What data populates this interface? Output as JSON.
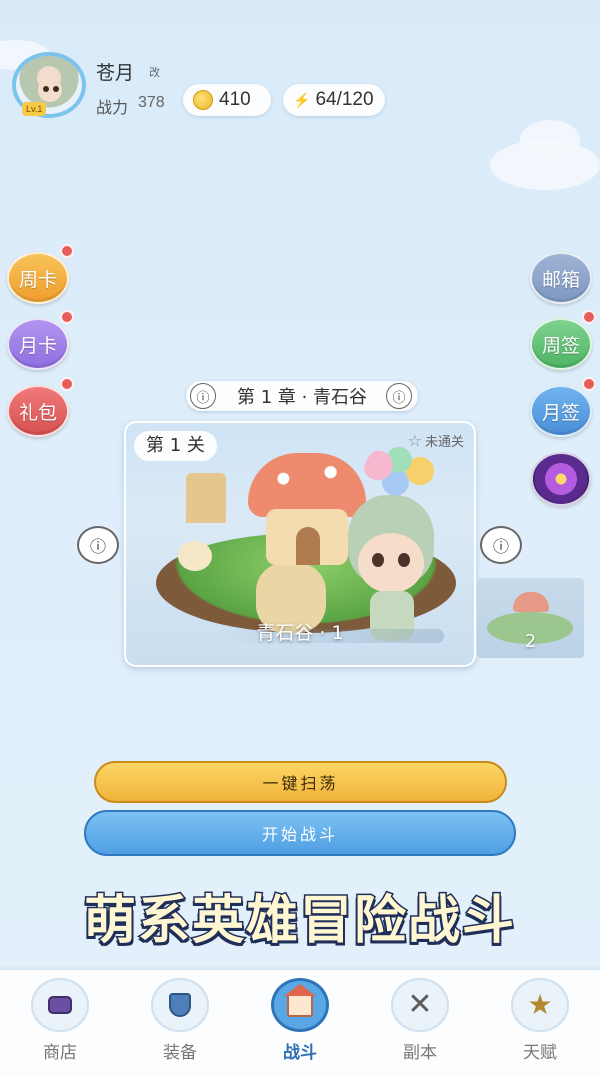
{
  "player": {
    "name": "苍月",
    "rename_label": "改",
    "level_badge": "Lv.1",
    "power_label": "战力",
    "power_value": "378"
  },
  "resources": {
    "coins": "410",
    "energy": "64/120"
  },
  "left_buttons": [
    {
      "label": "周卡",
      "badge": true
    },
    {
      "label": "月卡",
      "badge": true
    },
    {
      "label": "礼包",
      "badge": true
    }
  ],
  "right_buttons": [
    {
      "label": "邮箱",
      "badge": false
    },
    {
      "label": "周签",
      "badge": true
    },
    {
      "label": "月签",
      "badge": true
    }
  ],
  "chapter": {
    "title": "第 1 章 · 青石谷"
  },
  "stage": {
    "tag": "第 1 关",
    "status": "未通关",
    "name": "青石谷 · 1",
    "next_number": "2"
  },
  "actions": {
    "sweep": "一键扫荡",
    "fight": "开始战斗"
  },
  "banner": "萌系英雄冒险战斗",
  "nav": [
    {
      "label": "商店",
      "icon": "bag-icon"
    },
    {
      "label": "装备",
      "icon": "shield-icon"
    },
    {
      "label": "战斗",
      "icon": "house-icon",
      "active": true
    },
    {
      "label": "副本",
      "icon": "crossed-swords-icon"
    },
    {
      "label": "天赋",
      "icon": "star-icon"
    }
  ],
  "colors": {
    "background": "#dceefa",
    "accent_blue": "#4f9fe3",
    "accent_gold": "#f1b33b",
    "badge_red": "#e85c5c"
  }
}
